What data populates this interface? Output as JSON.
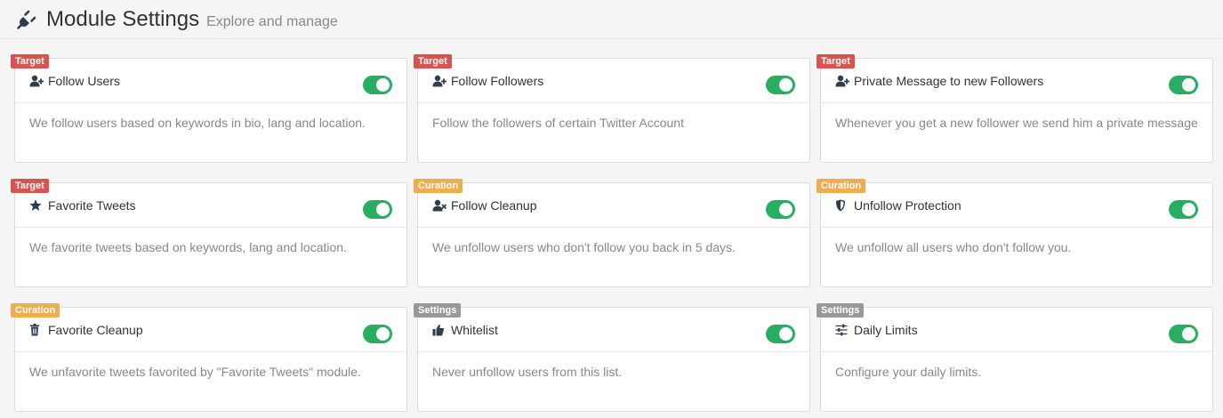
{
  "header": {
    "title": "Module Settings",
    "subtitle": "Explore and manage",
    "icon": "plug-icon"
  },
  "colors": {
    "target": "#d9534f",
    "curation": "#f0ad4e",
    "settings": "#999999",
    "toggle_on": "#27ae60"
  },
  "modules": [
    {
      "badge": "Target",
      "badge_type": "target",
      "icon": "user-plus-icon",
      "name": "Follow Users",
      "enabled": true,
      "description": "We follow users based on keywords in bio, lang and location."
    },
    {
      "badge": "Target",
      "badge_type": "target",
      "icon": "user-plus-icon",
      "name": "Follow Followers",
      "enabled": true,
      "description": "Follow the followers of certain Twitter Account"
    },
    {
      "badge": "Target",
      "badge_type": "target",
      "icon": "user-plus-icon",
      "name": "Private Message to new Followers",
      "enabled": true,
      "description": "Whenever you get a new follower we send him a private message"
    },
    {
      "badge": "Target",
      "badge_type": "target",
      "icon": "star-icon",
      "name": "Favorite Tweets",
      "enabled": true,
      "description": "We favorite tweets based on keywords, lang and location."
    },
    {
      "badge": "Curation",
      "badge_type": "curation",
      "icon": "user-times-icon",
      "name": "Follow Cleanup",
      "enabled": true,
      "description": "We unfollow users who don't follow you back in 5 days."
    },
    {
      "badge": "Curation",
      "badge_type": "curation",
      "icon": "shield-icon",
      "name": "Unfollow Protection",
      "enabled": true,
      "description": "We unfollow all users who don't follow you."
    },
    {
      "badge": "Curation",
      "badge_type": "curation",
      "icon": "trash-icon",
      "name": "Favorite Cleanup",
      "enabled": true,
      "description": "We unfavorite tweets favorited by \"Favorite Tweets\" module."
    },
    {
      "badge": "Settings",
      "badge_type": "settings",
      "icon": "thumbs-up-icon",
      "name": "Whitelist",
      "enabled": true,
      "description": "Never unfollow users from this list."
    },
    {
      "badge": "Settings",
      "badge_type": "settings",
      "icon": "sliders-icon",
      "name": "Daily Limits",
      "enabled": true,
      "description": "Configure your daily limits."
    }
  ]
}
